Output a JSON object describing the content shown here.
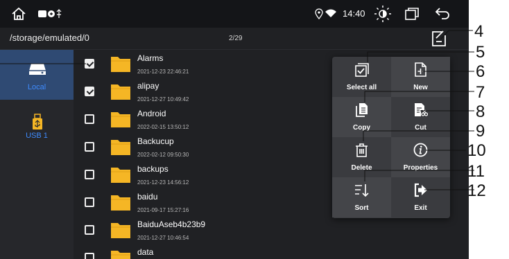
{
  "statusbar": {
    "time": "14:40",
    "icons": [
      "home-icon",
      "notification-icons",
      "location-icon",
      "wifi-icon",
      "brightness-icon",
      "window-icon",
      "back-icon"
    ]
  },
  "pathbar": {
    "path": "/storage/emulated/0",
    "count": "2/29",
    "menu_icon": "edit-menu-icon"
  },
  "sidebar": {
    "items": [
      {
        "label": "Local",
        "icon": "drive-icon",
        "active": true
      },
      {
        "label": "USB 1",
        "icon": "usb-icon",
        "active": false
      }
    ]
  },
  "files": [
    {
      "name": "Alarms",
      "date": "2021-12-23 22:46:21",
      "checked": true
    },
    {
      "name": "alipay",
      "date": "2021-12-27 10:49:42",
      "checked": true
    },
    {
      "name": "Android",
      "date": "2022-02-15 13:50:12",
      "checked": false
    },
    {
      "name": "Backucup",
      "date": "2022-02-12 09:50:30",
      "checked": false
    },
    {
      "name": "backups",
      "date": "2021-12-23 14:56:12",
      "checked": false
    },
    {
      "name": "baidu",
      "date": "2021-09-17 15:27:16",
      "checked": false
    },
    {
      "name": "BaiduAseb4b23b9",
      "date": "2021-12-27 10:46:54",
      "checked": false
    },
    {
      "name": "data",
      "date": "",
      "checked": false
    }
  ],
  "menu": {
    "items": [
      {
        "label": "Select all",
        "icon": "select-all-icon"
      },
      {
        "label": "New",
        "icon": "new-file-icon"
      },
      {
        "label": "Copy",
        "icon": "copy-icon"
      },
      {
        "label": "Cut",
        "icon": "cut-icon"
      },
      {
        "label": "Delete",
        "icon": "delete-icon"
      },
      {
        "label": "Properties",
        "icon": "info-icon"
      },
      {
        "label": "Sort",
        "icon": "sort-icon"
      },
      {
        "label": "Exit",
        "icon": "exit-icon"
      }
    ]
  },
  "callouts": [
    "4",
    "5",
    "6",
    "7",
    "8",
    "9",
    "10",
    "11",
    "12"
  ],
  "colors": {
    "background": "#202124",
    "sidebar_active": "#2f4a73",
    "accent": "#3f8cff",
    "folder": "#f5b625",
    "popup": "#3a3b3f"
  }
}
